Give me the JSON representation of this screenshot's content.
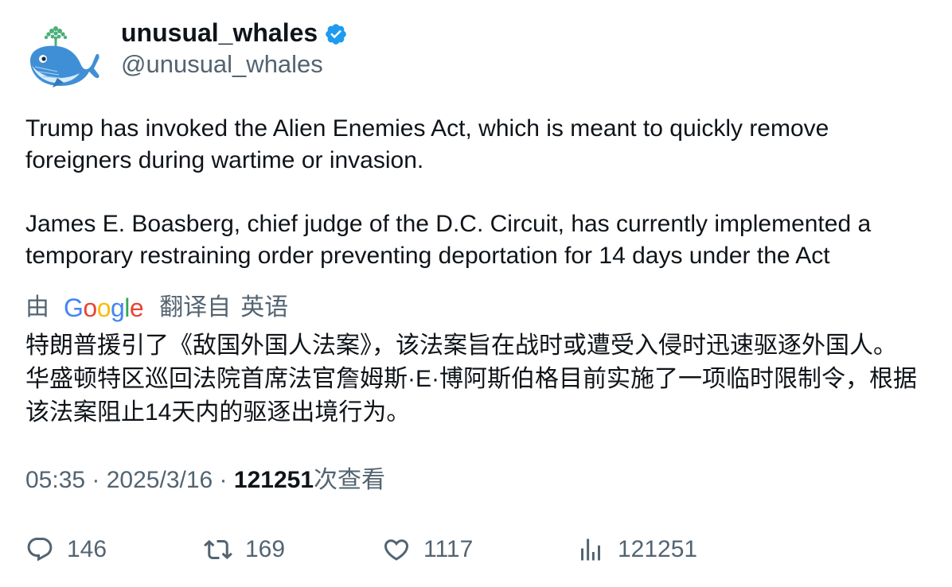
{
  "author": {
    "display_name": "unusual_whales",
    "handle": "@unusual_whales",
    "verified": true,
    "verified_color": "#1d9bf0",
    "avatar_icon": "whale-avatar-icon"
  },
  "tweet": {
    "paragraph_1": "Trump has invoked the Alien Enemies Act, which is meant to quickly remove foreigners during wartime or invasion.",
    "paragraph_2": "James E. Boasberg, chief judge of the D.C. Circuit, has currently implemented a temporary restraining order preventing deportation for 14 days under the Act"
  },
  "translation": {
    "by_label": "由",
    "provider_letters": [
      "G",
      "o",
      "o",
      "g",
      "l",
      "e"
    ],
    "translated_from_label": "翻译自",
    "source_language": "英语",
    "text": "特朗普援引了《敌国外国人法案》，该法案旨在战时或遭受入侵时迅速驱逐外国人。 华盛顿特区巡回法院首席法官詹姆斯·E·博阿斯伯格目前实施了一项临时限制令，根据该法案阻止14天内的驱逐出境行为。"
  },
  "meta": {
    "time": "05:35",
    "separator_1": " · ",
    "date": "2025/3/16",
    "separator_2": " · ",
    "views_count": "121251",
    "views_label": "次查看"
  },
  "actions": {
    "replies": "146",
    "retweets": "169",
    "likes": "1117",
    "views": "121251"
  },
  "colors": {
    "text_primary": "#0f1419",
    "text_secondary": "#536471",
    "google_blue": "#4285f4",
    "google_red": "#ea4335",
    "google_yellow": "#fbbc05",
    "google_green": "#34a853"
  }
}
